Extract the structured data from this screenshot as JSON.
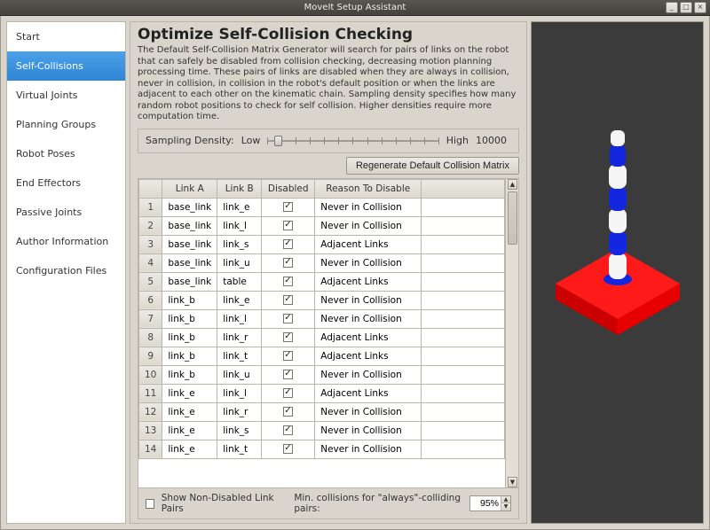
{
  "window": {
    "title": "MoveIt Setup Assistant"
  },
  "sidebar": {
    "items": [
      {
        "label": "Start"
      },
      {
        "label": "Self-Collisions"
      },
      {
        "label": "Virtual Joints"
      },
      {
        "label": "Planning Groups"
      },
      {
        "label": "Robot Poses"
      },
      {
        "label": "End Effectors"
      },
      {
        "label": "Passive Joints"
      },
      {
        "label": "Author Information"
      },
      {
        "label": "Configuration Files"
      }
    ],
    "active_index": 1
  },
  "page": {
    "title": "Optimize Self-Collision Checking",
    "description": "The Default Self-Collision Matrix Generator will search for pairs of links on the robot that can safely be disabled from collision checking, decreasing motion planning processing time. These pairs of links are disabled when they are always in collision, never in collision, in collision in the robot's default position or when the links are adjacent to each other on the kinematic chain. Sampling density specifies how many random robot positions to check for self collision. Higher densities require more computation time."
  },
  "density": {
    "label": "Sampling Density:",
    "low": "Low",
    "high": "High",
    "value": "10000"
  },
  "buttons": {
    "regenerate": "Regenerate Default Collision Matrix"
  },
  "table": {
    "headers": {
      "link_a": "Link A",
      "link_b": "Link B",
      "disabled": "Disabled",
      "reason": "Reason To Disable"
    },
    "rows": [
      {
        "n": "1",
        "a": "base_link",
        "b": "link_e",
        "disabled": true,
        "reason": "Never in Collision"
      },
      {
        "n": "2",
        "a": "base_link",
        "b": "link_l",
        "disabled": true,
        "reason": "Never in Collision"
      },
      {
        "n": "3",
        "a": "base_link",
        "b": "link_s",
        "disabled": true,
        "reason": "Adjacent Links"
      },
      {
        "n": "4",
        "a": "base_link",
        "b": "link_u",
        "disabled": true,
        "reason": "Never in Collision"
      },
      {
        "n": "5",
        "a": "base_link",
        "b": "table",
        "disabled": true,
        "reason": "Adjacent Links"
      },
      {
        "n": "6",
        "a": "link_b",
        "b": "link_e",
        "disabled": true,
        "reason": "Never in Collision"
      },
      {
        "n": "7",
        "a": "link_b",
        "b": "link_l",
        "disabled": true,
        "reason": "Never in Collision"
      },
      {
        "n": "8",
        "a": "link_b",
        "b": "link_r",
        "disabled": true,
        "reason": "Adjacent Links"
      },
      {
        "n": "9",
        "a": "link_b",
        "b": "link_t",
        "disabled": true,
        "reason": "Adjacent Links"
      },
      {
        "n": "10",
        "a": "link_b",
        "b": "link_u",
        "disabled": true,
        "reason": "Never in Collision"
      },
      {
        "n": "11",
        "a": "link_e",
        "b": "link_l",
        "disabled": true,
        "reason": "Adjacent Links"
      },
      {
        "n": "12",
        "a": "link_e",
        "b": "link_r",
        "disabled": true,
        "reason": "Never in Collision"
      },
      {
        "n": "13",
        "a": "link_e",
        "b": "link_s",
        "disabled": true,
        "reason": "Never in Collision"
      },
      {
        "n": "14",
        "a": "link_e",
        "b": "link_t",
        "disabled": true,
        "reason": "Never in Collision"
      }
    ]
  },
  "footer": {
    "show_non_disabled_label": "Show Non-Disabled Link Pairs",
    "show_non_disabled_checked": false,
    "min_collisions_label": "Min. collisions for \"always\"-colliding pairs:",
    "min_collisions_value": "95%"
  },
  "viewer": {
    "colors": {
      "bg": "#3b3b3b",
      "table": "#ff0000",
      "robot_blue": "#1326e0",
      "robot_white": "#f5f5f5"
    }
  }
}
